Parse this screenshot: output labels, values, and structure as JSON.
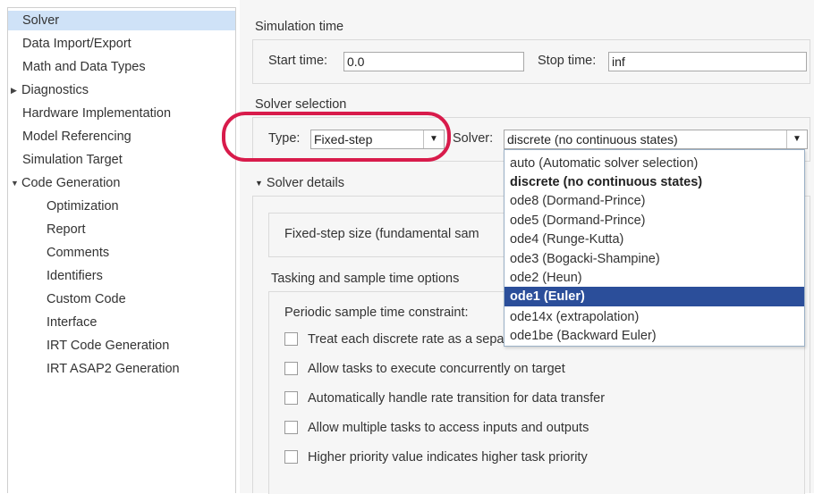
{
  "sidebar": {
    "items": [
      {
        "label": "Solver",
        "selected": true
      },
      {
        "label": "Data Import/Export"
      },
      {
        "label": "Math and Data Types"
      },
      {
        "label": "Diagnostics",
        "collapsed_arrow": "▶"
      },
      {
        "label": "Hardware Implementation"
      },
      {
        "label": "Model Referencing"
      },
      {
        "label": "Simulation Target"
      },
      {
        "label": "Code Generation",
        "expanded_arrow": "▼"
      },
      {
        "label": "Optimization"
      },
      {
        "label": "Report"
      },
      {
        "label": "Comments"
      },
      {
        "label": "Identifiers"
      },
      {
        "label": "Custom Code"
      },
      {
        "label": "Interface"
      },
      {
        "label": "IRT Code Generation"
      },
      {
        "label": "IRT ASAP2 Generation"
      }
    ]
  },
  "simulation_time": {
    "title": "Simulation time",
    "start_label": "Start time:",
    "start_value": "0.0",
    "stop_label": "Stop time:",
    "stop_value": "inf"
  },
  "solver_selection": {
    "title": "Solver selection",
    "type_label": "Type:",
    "type_value": "Fixed-step",
    "solver_label": "Solver:",
    "solver_value": "discrete (no continuous states)"
  },
  "solver_details": {
    "title": "Solver details",
    "arrow": "▼",
    "fixed_step_label": "Fixed-step size (fundamental sam",
    "tasking_title": "Tasking and sample time options",
    "periodic_label": "Periodic sample time constraint:",
    "checkboxes": [
      {
        "label": "Treat each discrete rate as a separate task",
        "checked": false
      },
      {
        "label": "Allow tasks to execute concurrently on target",
        "checked": false
      },
      {
        "label": "Automatically handle rate transition for data transfer",
        "checked": false
      },
      {
        "label": "Allow multiple tasks to access inputs and outputs",
        "checked": false
      },
      {
        "label": "Higher priority value indicates higher task priority",
        "checked": false
      }
    ]
  },
  "solver_dropdown": {
    "options": [
      {
        "label": "auto (Automatic solver selection)"
      },
      {
        "label": "discrete (no continuous states)",
        "current": true
      },
      {
        "label": "ode8 (Dormand-Prince)"
      },
      {
        "label": "ode5 (Dormand-Prince)"
      },
      {
        "label": "ode4 (Runge-Kutta)"
      },
      {
        "label": "ode3 (Bogacki-Shampine)"
      },
      {
        "label": "ode2 (Heun)"
      },
      {
        "label": "ode1 (Euler)",
        "highlighted": true
      },
      {
        "label": "ode14x (extrapolation)"
      },
      {
        "label": "ode1be (Backward Euler)"
      }
    ]
  },
  "icons": {
    "dropdown_arrow": "▼"
  },
  "colors": {
    "selected_sidebar": "#cfe2f7",
    "highlight_option": "#2b4e9a",
    "annotation_ring": "#d81b4b"
  }
}
